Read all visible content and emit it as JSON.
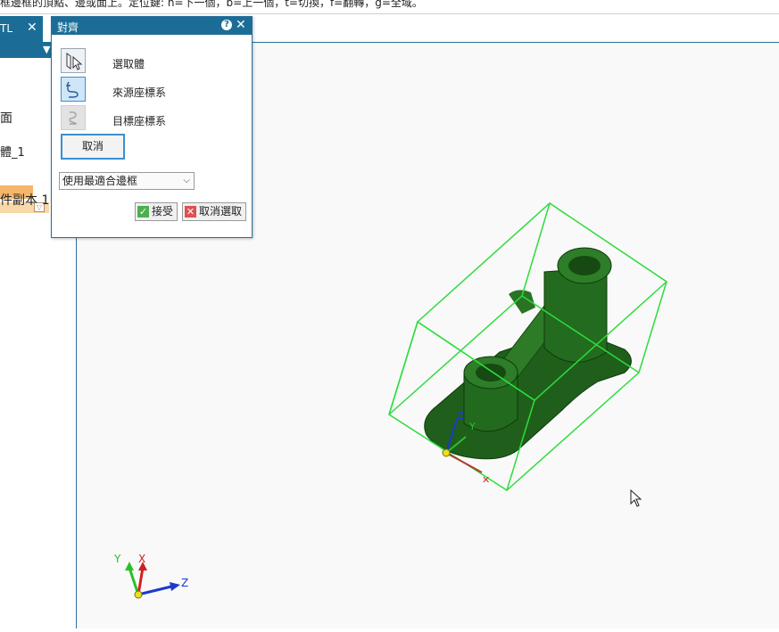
{
  "status_bar": {
    "hint": "框邊框的頂點、邊或面上。定位鍵: n=下一個，b=上一個，t=切換，f=翻轉，g=全域。"
  },
  "tab": {
    "label": "TL",
    "close": "✕"
  },
  "left_panel": {
    "items": [
      "面",
      "體_1",
      "件副本 1"
    ]
  },
  "dialog": {
    "title": "對齊",
    "help": "?",
    "close": "✕",
    "steps": [
      {
        "label": "選取體",
        "icon": "select-body-icon",
        "state": "normal"
      },
      {
        "label": "來源座標系",
        "icon": "source-coordinate-system-icon",
        "state": "active"
      },
      {
        "label": "目標座標系",
        "icon": "target-coordinate-system-icon",
        "state": "disabled"
      }
    ],
    "cancel_button": "取消",
    "bounding_option": "使用最適合邊框",
    "accept_button": "接受",
    "deselect_button": "取消選取"
  },
  "triad": {
    "x": "X",
    "y": "Y",
    "z": "Z"
  },
  "colors": {
    "accent": "#1b6d97",
    "model": "#1e5e1a",
    "bounding_box": "#2ddc3c",
    "highlight": "#f5b66a"
  }
}
